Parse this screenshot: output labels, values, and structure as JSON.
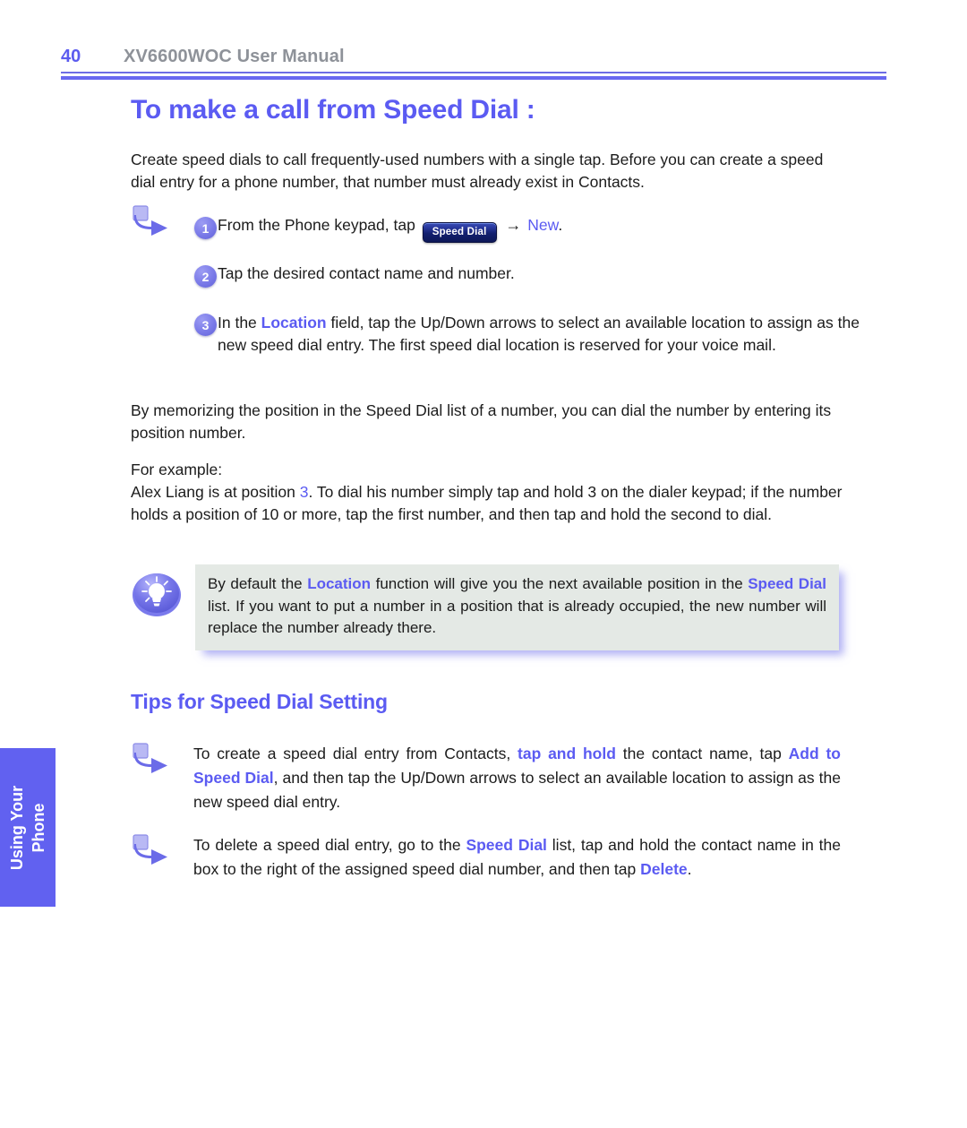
{
  "header": {
    "page_number": "40",
    "manual_title": "XV6600WOC User Manual"
  },
  "title": "To make a call from Speed Dial :",
  "intro_paragraph": "Create speed dials to call frequently-used numbers with a single tap. Before you can create a speed dial entry for a phone number, that number must already exist in Contacts.",
  "steps": [
    {
      "number": "1",
      "text_before": "From the Phone keypad, tap",
      "button_label": "Speed Dial",
      "arrow": "→",
      "link_label": "New",
      "text_after": "."
    },
    {
      "number": "2",
      "text": "Tap the desired contact name and number."
    },
    {
      "number": "3",
      "text_before": "In the",
      "keyword": "Location",
      "text_after": "field, tap the Up/Down arrows to select an available location to assign as the new speed dial entry. The first speed dial location is reserved for your voice mail."
    }
  ],
  "memorizing_paragraph": "By memorizing the position in the Speed Dial list of a number, you can dial the number by entering its position number.",
  "example": {
    "label": "For example:",
    "text_before": "Alex Liang is at position",
    "highlight": "3",
    "text_after": ". To dial his number simply tap and hold 3 on the dialer keypad; if the number holds a position of 10 or more, tap the first number, and then tap and hold the second to dial."
  },
  "tip": {
    "icon": "lightbulb-icon",
    "text_part1": "By default the",
    "keyword1": "Location",
    "text_part2": "function will give you the next available position in the",
    "keyword2": "Speed Dial",
    "text_part3": "list. If you want to put a number in a position that is already occupied, the new number will replace the number already there."
  },
  "tips_heading": "Tips for Speed Dial Setting",
  "tips_items": [
    {
      "text_part1": "To create a speed dial entry from Contacts,",
      "keyword1": "tap and hold",
      "text_part2": "the contact name, tap",
      "keyword2": "Add to Speed Dial",
      "text_part3": ", and then tap the Up/Down arrows to select an available location to assign as the new speed dial entry."
    },
    {
      "text_part1": "To delete a speed dial entry, go to the",
      "keyword1": "Speed Dial",
      "text_part2": "list, tap and hold the contact name in the box to the right of the assigned speed dial number, and then tap",
      "keyword2": "Delete",
      "text_part3": "."
    }
  ],
  "side_tab": {
    "line1": "Using Your",
    "line2": "Phone"
  },
  "colors": {
    "accent": "#5b5bf2",
    "tab_bg": "#6161f0",
    "header_gray": "#8e9299",
    "tip_bg": "#e4e9e5",
    "button_navy": "#121f6e"
  }
}
